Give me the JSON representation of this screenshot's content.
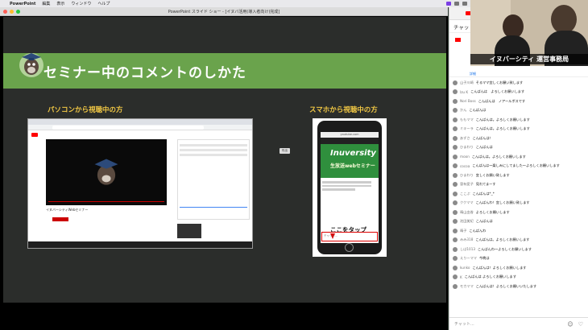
{
  "menubar": {
    "app": "PowerPoint",
    "items": [
      "編集",
      "表示",
      "ウィンドウ",
      "ヘルプ"
    ]
  },
  "window": {
    "title": "PowerPoint スライド ショー - [イヌバ活用(導入者向け)完成]"
  },
  "slide": {
    "title": "セミナー中のコメントのしかた",
    "pc_heading": "パソコンから視聴中の方",
    "sp_heading": "スマホから視聴中の方",
    "pc_channel": "イヌバーシティWebセミナー",
    "badge": "吹出",
    "phone": {
      "url": "youtube.com",
      "brand_line1": "Inuversity",
      "brand_line2": "生放送webセミナー",
      "tap_label": "ここをタップ",
      "chat_placeholder": "チャット..."
    }
  },
  "chat": {
    "tab_label": "youtube",
    "header": "チャット",
    "details": "詳細",
    "input_placeholder": "チャット...",
    "messages": [
      {
        "name": "山子川崎",
        "text": "そるママ宜しくお願い致します"
      },
      {
        "name": "Izu K",
        "text": "こんばんは　よろしくお願いします"
      },
      {
        "name": "Nori Boss",
        "text": "こんばんは　ノアールボスです"
      },
      {
        "name": "かん",
        "text": "こんばんは"
      },
      {
        "name": "ももママ",
        "text": "こんばんは。よろしくお願いします"
      },
      {
        "name": "ミキーラ",
        "text": "こんばんは。よろしくお願いします"
      },
      {
        "name": "あずさ",
        "text": "こんばんは！"
      },
      {
        "name": "ひまわり",
        "text": "こんばんは"
      },
      {
        "name": "moon",
        "text": "こんばんは。よろしくお願いします"
      },
      {
        "name": "cocoa",
        "text": "こんばんは〜楽しみにしてました〜よろしくお願いします"
      },
      {
        "name": "ひまわり",
        "text": "宜しくお願い致します"
      },
      {
        "name": "冒有愛子",
        "text": "見れてまーす"
      },
      {
        "name": "ここぷ",
        "text": "こんばんは*_*"
      },
      {
        "name": "ククママ",
        "text": "こんばんわ！宜しくお願い致します"
      },
      {
        "name": "晴山由香",
        "text": "よろしくお願いします"
      },
      {
        "name": "池田美紀",
        "text": "こんばんは"
      },
      {
        "name": "晴子",
        "text": "こんばんわ"
      },
      {
        "name": "みみ318",
        "text": "こんばんは。よろしくお願いします"
      },
      {
        "name": "しば1013",
        "text": "こんばんわ〜よろしくお願いします"
      },
      {
        "name": "えりーママ",
        "text": "今晩は"
      },
      {
        "name": "kunko",
        "text": "こんばんは！よろしくお願いします"
      },
      {
        "name": "K",
        "text": "こんばんは よろしくお願いします"
      },
      {
        "name": "モカママ",
        "text": "こんばんは！よろしくお願いいたします"
      }
    ]
  },
  "cam": {
    "label": "イヌバーシティ 運営事務局"
  },
  "colors": {
    "banner": "#6aa34c",
    "heading": "#f1c744",
    "slide_bg": "#2b2d2b"
  }
}
